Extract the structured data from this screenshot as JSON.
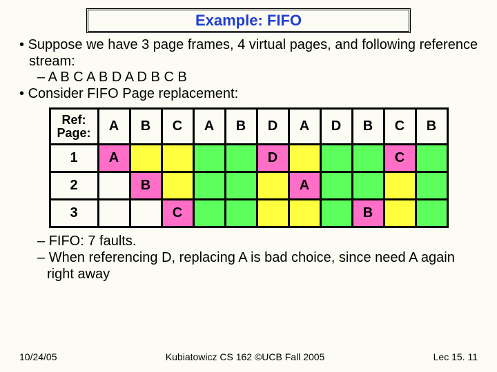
{
  "title": "Example: FIFO",
  "bullets": {
    "b1": "Suppose we have 3 page frames, 4 virtual pages, and following reference stream:",
    "b1a": "A B C A B D A D B C B",
    "b2": "Consider FIFO Page replacement:"
  },
  "table": {
    "hdr0a": "Ref:",
    "hdr0b": "Page:",
    "refs": [
      "A",
      "B",
      "C",
      "A",
      "B",
      "D",
      "A",
      "D",
      "B",
      "C",
      "B"
    ],
    "rows": [
      "1",
      "2",
      "3"
    ]
  },
  "chart_data": {
    "type": "table",
    "title": "FIFO page replacement trace",
    "columns": [
      "Ref",
      "A",
      "B",
      "C",
      "A",
      "B",
      "D",
      "A",
      "D",
      "B",
      "C",
      "B"
    ],
    "frames": {
      "1": [
        {
          "col": 1,
          "value": "A",
          "state": "fault"
        },
        {
          "col": 2,
          "state": "keep"
        },
        {
          "col": 3,
          "state": "keep"
        },
        {
          "col": 4,
          "state": "hit"
        },
        {
          "col": 5,
          "state": "hit"
        },
        {
          "col": 6,
          "value": "D",
          "state": "fault"
        },
        {
          "col": 7,
          "state": "keep"
        },
        {
          "col": 8,
          "state": "hit"
        },
        {
          "col": 9,
          "state": "hit"
        },
        {
          "col": 10,
          "value": "C",
          "state": "fault"
        },
        {
          "col": 11,
          "state": "hit"
        }
      ],
      "2": [
        {
          "col": 1,
          "state": "empty"
        },
        {
          "col": 2,
          "value": "B",
          "state": "fault"
        },
        {
          "col": 3,
          "state": "keep"
        },
        {
          "col": 4,
          "state": "hit"
        },
        {
          "col": 5,
          "state": "hit"
        },
        {
          "col": 6,
          "state": "keep"
        },
        {
          "col": 7,
          "value": "A",
          "state": "fault"
        },
        {
          "col": 8,
          "state": "hit"
        },
        {
          "col": 9,
          "state": "hit"
        },
        {
          "col": 10,
          "state": "keep"
        },
        {
          "col": 11,
          "state": "hit"
        }
      ],
      "3": [
        {
          "col": 1,
          "state": "empty"
        },
        {
          "col": 2,
          "state": "empty"
        },
        {
          "col": 3,
          "value": "C",
          "state": "fault"
        },
        {
          "col": 4,
          "state": "hit"
        },
        {
          "col": 5,
          "state": "hit"
        },
        {
          "col": 6,
          "state": "keep"
        },
        {
          "col": 7,
          "state": "keep"
        },
        {
          "col": 8,
          "state": "hit"
        },
        {
          "col": 9,
          "value": "B",
          "state": "fault"
        },
        {
          "col": 10,
          "state": "keep"
        },
        {
          "col": 11,
          "state": "hit"
        }
      ]
    },
    "legend": {
      "fault": "pink",
      "keep": "yellow",
      "hit": "green",
      "empty": "white"
    },
    "faults_total": 7
  },
  "post": {
    "p1": "FIFO: 7 faults.",
    "p2": "When referencing D, replacing A is bad choice, since need A again right away"
  },
  "footer": {
    "left": "10/24/05",
    "center": "Kubiatowicz CS 162 ©UCB Fall 2005",
    "right": "Lec 15. 11"
  }
}
